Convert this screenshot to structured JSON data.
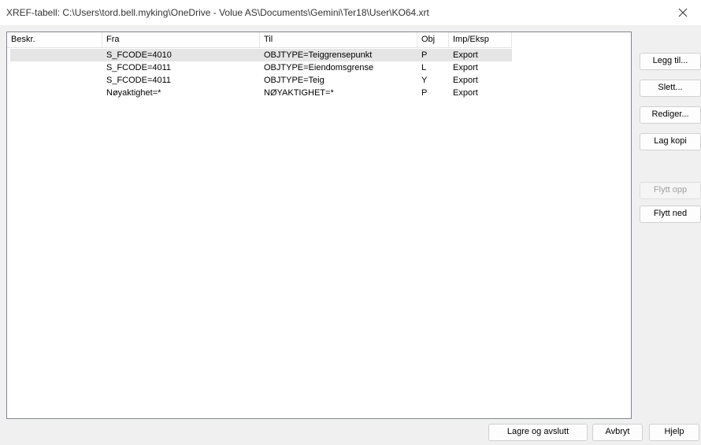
{
  "window": {
    "title": "XREF-tabell:  C:\\Users\\tord.bell.myking\\OneDrive - Volue AS\\Documents\\Gemini\\Ter18\\User\\KO64.xrt"
  },
  "table": {
    "columns": [
      "Beskr.",
      "Fra",
      "Til",
      "Obj",
      "Imp/Eksp"
    ],
    "rows": [
      {
        "beskr": "",
        "fra": "S_FCODE=4010",
        "til": "OBJTYPE=Teiggrensepunkt",
        "obj": "P",
        "impeksp": "Export"
      },
      {
        "beskr": "",
        "fra": "S_FCODE=4011",
        "til": "OBJTYPE=Eiendomsgrense",
        "obj": "L",
        "impeksp": "Export"
      },
      {
        "beskr": "",
        "fra": "S_FCODE=4011",
        "til": "OBJTYPE=Teig",
        "obj": "Y",
        "impeksp": "Export"
      },
      {
        "beskr": "",
        "fra": "Nøyaktighet=*",
        "til": "NØYAKTIGHET=*",
        "obj": "P",
        "impeksp": "Export"
      }
    ]
  },
  "side_buttons": {
    "add": "Legg til...",
    "delete": "Slett...",
    "edit": "Rediger...",
    "copy": "Lag kopi",
    "move_up": "Flytt opp",
    "move_down": "Flytt ned"
  },
  "bottom_buttons": {
    "save": "Lagre og avslutt",
    "cancel": "Avbryt",
    "help": "Hjelp"
  }
}
